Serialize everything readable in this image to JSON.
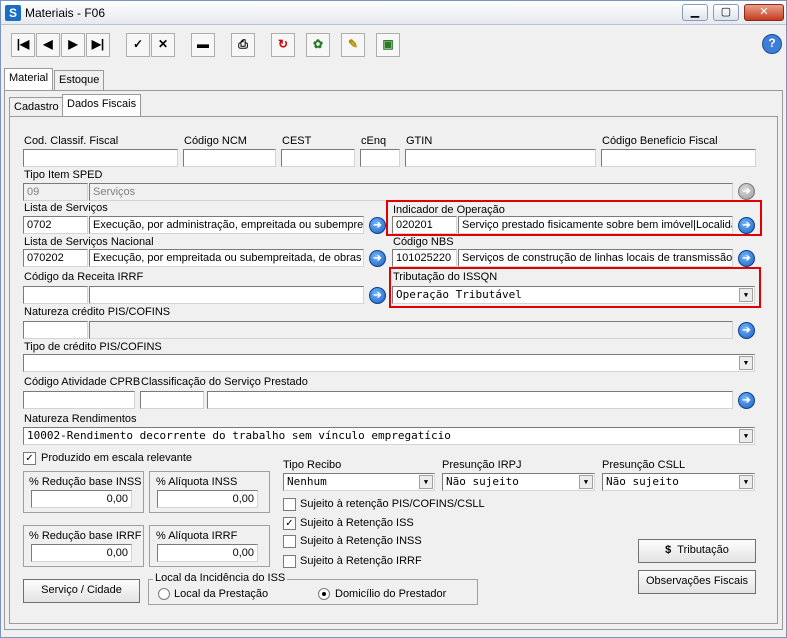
{
  "window": {
    "title": "Materiais - F06",
    "app_icon": "S"
  },
  "toolbar": {
    "help": "?"
  },
  "tabs_top": [
    "Material",
    "Estoque"
  ],
  "tabs_sub": [
    "Cadastro",
    "Dados Fiscais"
  ],
  "fields": {
    "cod_classif_label": "Cod. Classif. Fiscal",
    "ncm_label": "Código NCM",
    "cest_label": "CEST",
    "cenq_label": "cEnq",
    "gtin_label": "GTIN",
    "beneficio_label": "Código Benefício Fiscal",
    "tipo_item_label": "Tipo Item SPED",
    "tipo_item_code": "09",
    "tipo_item_desc": "Serviços",
    "lista_servicos_label": "Lista de Serviços",
    "lista_servicos_code": "0702",
    "lista_servicos_desc": "Execução, por administração, empreitada ou subempreitada",
    "indicador_label": "Indicador de Operação",
    "indicador_code": "020201",
    "indicador_desc": "Serviço prestado fisicamente sobre bem imóvel|Localidade",
    "lista_nacional_label": "Lista de Serviços Nacional",
    "lista_nacional_code": "070202",
    "lista_nacional_desc": "Execução, por empreitada ou subempreitada, de obras de",
    "nbs_label": "Código NBS",
    "nbs_code": "101025220",
    "nbs_desc": "Serviços de construção de linhas locais de transmissão",
    "receita_label": "Código da Receita IRRF",
    "tributacao_label": "Tributação do ISSQN",
    "tributacao_value": "Operação Tributável",
    "natureza_label": "Natureza crédito PIS/COFINS",
    "tipo_credito_label": "Tipo de crédito PIS/COFINS",
    "cprb_label": "Código Atividade CPRB",
    "classif_servico_label": "Classificação do Serviço Prestado",
    "natureza_rend_label": "Natureza Rendimentos",
    "natureza_rend_value": "10002-Rendimento decorrente do trabalho sem vínculo empregatício",
    "produzido_label": "Produzido em escala relevante",
    "red_inss_label": "% Redução base INSS",
    "red_inss_value": "0,00",
    "aliq_inss_label": "% Alíquota INSS",
    "aliq_inss_value": "0,00",
    "red_irrf_label": "% Redução base IRRF",
    "red_irrf_value": "0,00",
    "aliq_irrf_label": "% Alíquota IRRF",
    "aliq_irrf_value": "0,00",
    "tipo_recibo_label": "Tipo Recibo",
    "tipo_recibo_value": "Nenhum",
    "irpj_label": "Presunção IRPJ",
    "irpj_value": "Não sujeito",
    "csll_label": "Presunção CSLL",
    "csll_value": "Não sujeito",
    "ret_pis_label": "Sujeito à retenção PIS/COFINS/CSLL",
    "ret_iss_label": "Sujeito à Retenção ISS",
    "ret_inss_label": "Sujeito à Retenção INSS",
    "ret_irrf_label": "Sujeito à Retenção IRRF"
  },
  "buttons": {
    "servico_cidade": "Serviço / Cidade",
    "tributacao": "Tributação",
    "observacoes": "Observações Fiscais"
  },
  "local_incidencia": {
    "label": "Local da Incidência do ISS",
    "opt1": "Local da Prestação",
    "opt2": "Domicílio do Prestador"
  },
  "highlight_color": "#e00000"
}
